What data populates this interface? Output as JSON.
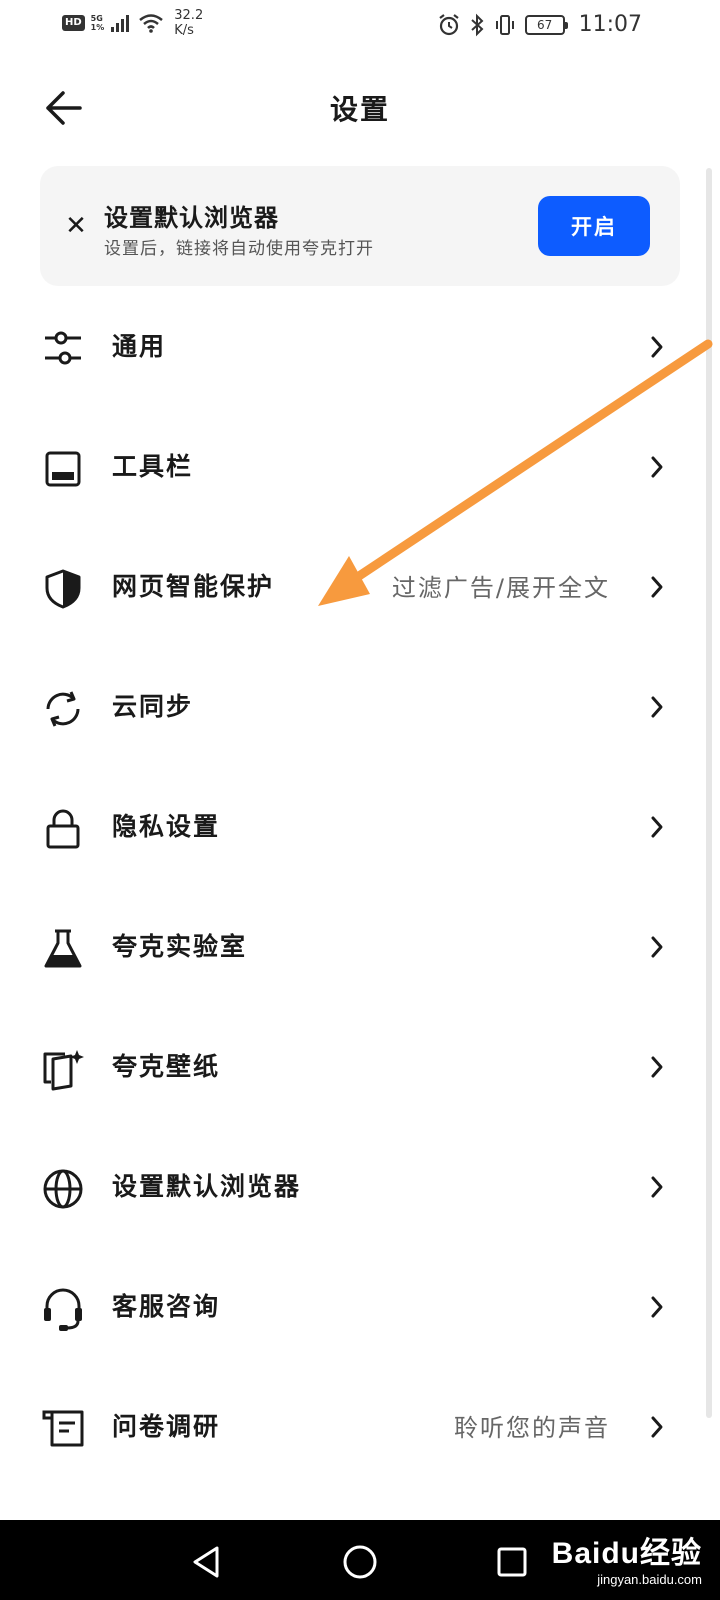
{
  "status_bar": {
    "hd": "HD",
    "network": "5G",
    "network_sub": "1%",
    "speed_value": "32.2",
    "speed_unit": "K/s",
    "battery": "67",
    "time": "11:07"
  },
  "header": {
    "title": "设置"
  },
  "banner": {
    "title": "设置默认浏览器",
    "subtitle": "设置后，链接将自动使用夸克打开",
    "button": "开启"
  },
  "menu": [
    {
      "label": "通用",
      "hint": "",
      "icon": "sliders-icon"
    },
    {
      "label": "工具栏",
      "hint": "",
      "icon": "toolbar-icon"
    },
    {
      "label": "网页智能保护",
      "hint": "过滤广告/展开全文",
      "icon": "shield-icon"
    },
    {
      "label": "云同步",
      "hint": "",
      "icon": "sync-icon"
    },
    {
      "label": "隐私设置",
      "hint": "",
      "icon": "lock-icon"
    },
    {
      "label": "夸克实验室",
      "hint": "",
      "icon": "flask-icon"
    },
    {
      "label": "夸克壁纸",
      "hint": "",
      "icon": "wallpaper-icon"
    },
    {
      "label": "设置默认浏览器",
      "hint": "",
      "icon": "globe-icon"
    },
    {
      "label": "客服咨询",
      "hint": "",
      "icon": "headset-icon"
    },
    {
      "label": "问卷调研",
      "hint": "聆听您的声音",
      "icon": "survey-icon"
    }
  ],
  "watermark": {
    "main": "Baidu经验",
    "sub": "jingyan.baidu.com"
  },
  "colors": {
    "accent": "#0d5cff",
    "annotation_arrow": "#f79a3e",
    "banner_bg": "#f5f5f5"
  }
}
